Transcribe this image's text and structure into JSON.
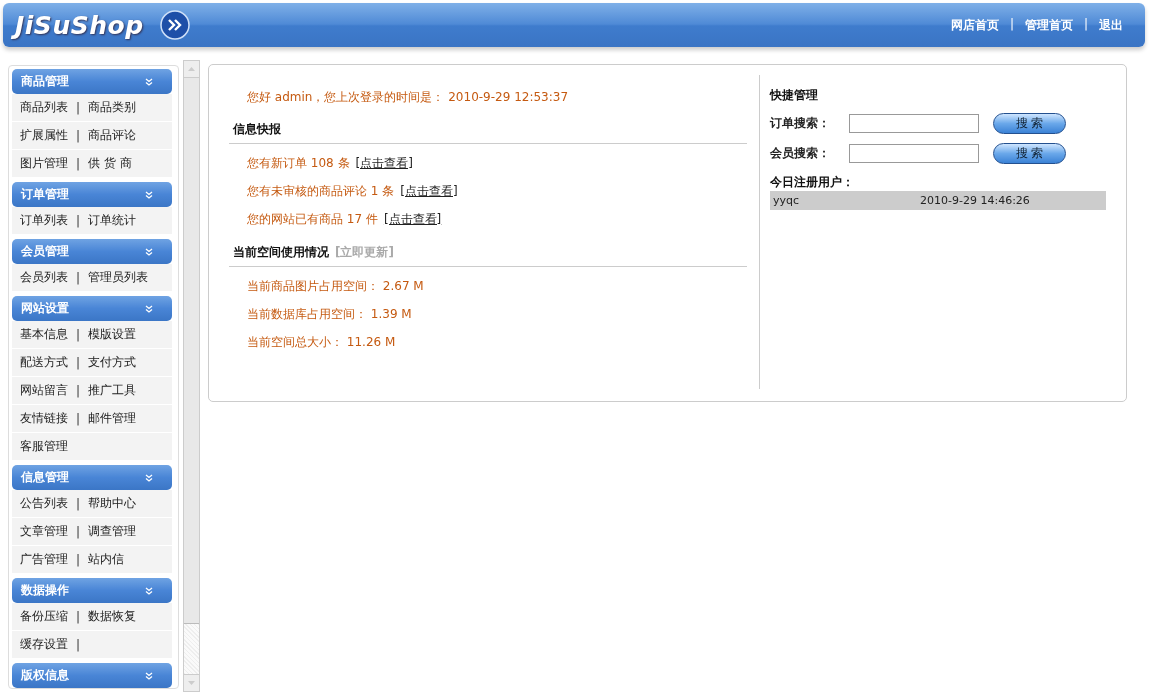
{
  "header": {
    "logo": "JiSuShop",
    "nav": [
      {
        "kind": "link",
        "text": "网店首页"
      },
      {
        "kind": "sep",
        "text": "|"
      },
      {
        "kind": "link",
        "text": "管理首页"
      },
      {
        "kind": "sep",
        "text": "|"
      },
      {
        "kind": "link",
        "text": "退出"
      }
    ]
  },
  "sidebar": {
    "sections": [
      {
        "title": "商品管理",
        "rows": [
          [
            {
              "kind": "link",
              "text": "商品列表"
            },
            {
              "kind": "sep",
              "text": "|"
            },
            {
              "kind": "link",
              "text": "商品类别"
            }
          ],
          [
            {
              "kind": "link",
              "text": "扩展属性"
            },
            {
              "kind": "sep",
              "text": "|"
            },
            {
              "kind": "link",
              "text": "商品评论"
            }
          ],
          [
            {
              "kind": "link",
              "text": "图片管理"
            },
            {
              "kind": "sep",
              "text": "|"
            },
            {
              "kind": "link",
              "text": "供 货 商"
            }
          ]
        ]
      },
      {
        "title": "订单管理",
        "rows": [
          [
            {
              "kind": "link",
              "text": "订单列表"
            },
            {
              "kind": "sep",
              "text": "|"
            },
            {
              "kind": "link",
              "text": "订单统计"
            }
          ]
        ]
      },
      {
        "title": "会员管理",
        "rows": [
          [
            {
              "kind": "link",
              "text": "会员列表"
            },
            {
              "kind": "sep",
              "text": "|"
            },
            {
              "kind": "link",
              "text": "管理员列表"
            }
          ]
        ]
      },
      {
        "title": "网站设置",
        "rows": [
          [
            {
              "kind": "link",
              "text": "基本信息"
            },
            {
              "kind": "sep",
              "text": "|"
            },
            {
              "kind": "link",
              "text": "模版设置"
            }
          ],
          [
            {
              "kind": "link",
              "text": "配送方式"
            },
            {
              "kind": "sep",
              "text": "|"
            },
            {
              "kind": "link",
              "text": "支付方式"
            }
          ],
          [
            {
              "kind": "link",
              "text": "网站留言"
            },
            {
              "kind": "sep",
              "text": "|"
            },
            {
              "kind": "link",
              "text": "推广工具"
            }
          ],
          [
            {
              "kind": "link",
              "text": "友情链接"
            },
            {
              "kind": "sep",
              "text": "|"
            },
            {
              "kind": "link",
              "text": "邮件管理"
            }
          ],
          [
            {
              "kind": "link",
              "text": "客服管理"
            }
          ]
        ]
      },
      {
        "title": "信息管理",
        "rows": [
          [
            {
              "kind": "link",
              "text": "公告列表"
            },
            {
              "kind": "sep",
              "text": "|"
            },
            {
              "kind": "link",
              "text": "帮助中心"
            }
          ],
          [
            {
              "kind": "link",
              "text": "文章管理"
            },
            {
              "kind": "sep",
              "text": "|"
            },
            {
              "kind": "link",
              "text": "调查管理"
            }
          ],
          [
            {
              "kind": "link",
              "text": "广告管理"
            },
            {
              "kind": "sep",
              "text": "|"
            },
            {
              "kind": "link",
              "text": "站内信"
            }
          ]
        ]
      },
      {
        "title": "数据操作",
        "rows": [
          [
            {
              "kind": "link",
              "text": "备份压缩"
            },
            {
              "kind": "sep",
              "text": "|"
            },
            {
              "kind": "link",
              "text": "数据恢复"
            }
          ],
          [
            {
              "kind": "link",
              "text": "缓存设置"
            },
            {
              "kind": "sep",
              "text": "|"
            }
          ]
        ]
      },
      {
        "title": "版权信息"
      }
    ]
  },
  "welcome": "您好 admin，您上次登录的时间是： 2010-9-29 12:53:37",
  "news": {
    "title": "信息快报",
    "items": [
      {
        "text": "您有新订单 108 条",
        "link": "[点击查看]"
      },
      {
        "text": "您有未审核的商品评论 1 条",
        "link": "[点击查看]"
      },
      {
        "text": "您的网站已有商品 17 件",
        "link": "[点击查看]"
      }
    ]
  },
  "space": {
    "title": "当前空间使用情况",
    "action": "[立即更新]",
    "items": [
      "当前商品图片占用空间： 2.67 M",
      "当前数据库占用空间： 1.39 M",
      "当前空间总大小： 11.26 M"
    ]
  },
  "quick": {
    "title": "快捷管理",
    "searches": [
      {
        "label": "订单搜索：",
        "button": "搜 索"
      },
      {
        "label": "会员搜索：",
        "button": "搜 索"
      }
    ],
    "users_title": "今日注册用户：",
    "users": [
      {
        "name": "yyqc",
        "time": "2010-9-29 14:46:26"
      }
    ]
  }
}
